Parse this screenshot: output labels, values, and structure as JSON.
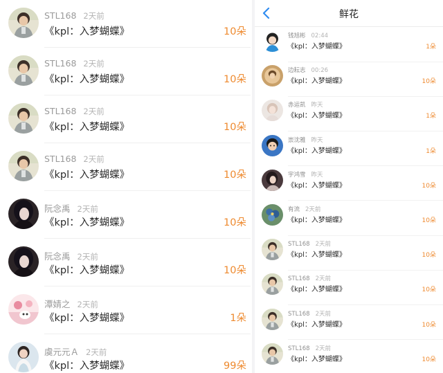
{
  "left_list": {
    "items": [
      {
        "user": "STL168",
        "time": "2天前",
        "gift": "《kpl：入梦蝴蝶》",
        "count": "10朵",
        "avatar": "stl-avatar"
      },
      {
        "user": "STL168",
        "time": "2天前",
        "gift": "《kpl：入梦蝴蝶》",
        "count": "10朵",
        "avatar": "stl-avatar"
      },
      {
        "user": "STL168",
        "time": "2天前",
        "gift": "《kpl：入梦蝴蝶》",
        "count": "10朵",
        "avatar": "stl-avatar"
      },
      {
        "user": "STL168",
        "time": "2天前",
        "gift": "《kpl：入梦蝴蝶》",
        "count": "10朵",
        "avatar": "stl-avatar"
      },
      {
        "user": "阮念禹",
        "time": "2天前",
        "gift": "《kpl：入梦蝴蝶》",
        "count": "10朵",
        "avatar": "dark-hair-avatar"
      },
      {
        "user": "阮念禹",
        "time": "2天前",
        "gift": "《kpl：入梦蝴蝶》",
        "count": "10朵",
        "avatar": "dark-hair-avatar"
      },
      {
        "user": "潭婧之",
        "time": "2天前",
        "gift": "《kpl：入梦蝴蝶》",
        "count": "1朵",
        "avatar": "pink-avatar"
      },
      {
        "user": "虞元元Ａ",
        "time": "2天前",
        "gift": "《kpl：入梦蝴蝶》",
        "count": "99朵",
        "avatar": "girl-avatar"
      }
    ]
  },
  "right_app": {
    "title": "鲜花",
    "back_icon": "chevron-left-icon",
    "items": [
      {
        "user": "钱旭彬",
        "time": "02:44",
        "gift": "《kpl：入梦蝴蝶》",
        "count": "1朵",
        "avatar": "cartoon-avatar"
      },
      {
        "user": "边耘志",
        "time": "00:26",
        "gift": "《kpl：入梦蝴蝶》",
        "count": "10朵",
        "avatar": "warm-avatar"
      },
      {
        "user": "赤运凯",
        "time": "昨天",
        "gift": "《kpl：入梦蝴蝶》",
        "count": "1朵",
        "avatar": "light-avatar"
      },
      {
        "user": "崇沈雅",
        "time": "昨天",
        "gift": "《kpl：入梦蝴蝶》",
        "count": "1朵",
        "avatar": "kid-avatar"
      },
      {
        "user": "宇鸿雪",
        "time": "昨天",
        "gift": "《kpl：入梦蝴蝶》",
        "count": "10朵",
        "avatar": "woman-avatar"
      },
      {
        "user": "有流",
        "time": "2天前",
        "gift": "《kpl：入梦蝴蝶》",
        "count": "10朵",
        "avatar": "flower-avatar"
      },
      {
        "user": "STL168",
        "time": "2天前",
        "gift": "《kpl：入梦蝴蝶》",
        "count": "10朵",
        "avatar": "stl-avatar"
      },
      {
        "user": "STL168",
        "time": "2天前",
        "gift": "《kpl：入梦蝴蝶》",
        "count": "10朵",
        "avatar": "stl-avatar"
      },
      {
        "user": "STL168",
        "time": "2天前",
        "gift": "《kpl：入梦蝴蝶》",
        "count": "10朵",
        "avatar": "stl-avatar"
      },
      {
        "user": "STL168",
        "time": "2天前",
        "gift": "《kpl：入梦蝴蝶》",
        "count": "10朵",
        "avatar": "stl-avatar"
      }
    ]
  },
  "colors": {
    "accent_orange": "#ee8a2f",
    "back_blue": "#2f8cf0",
    "name_gray": "#9a9a9a",
    "text_dark": "#2b2b2b"
  }
}
